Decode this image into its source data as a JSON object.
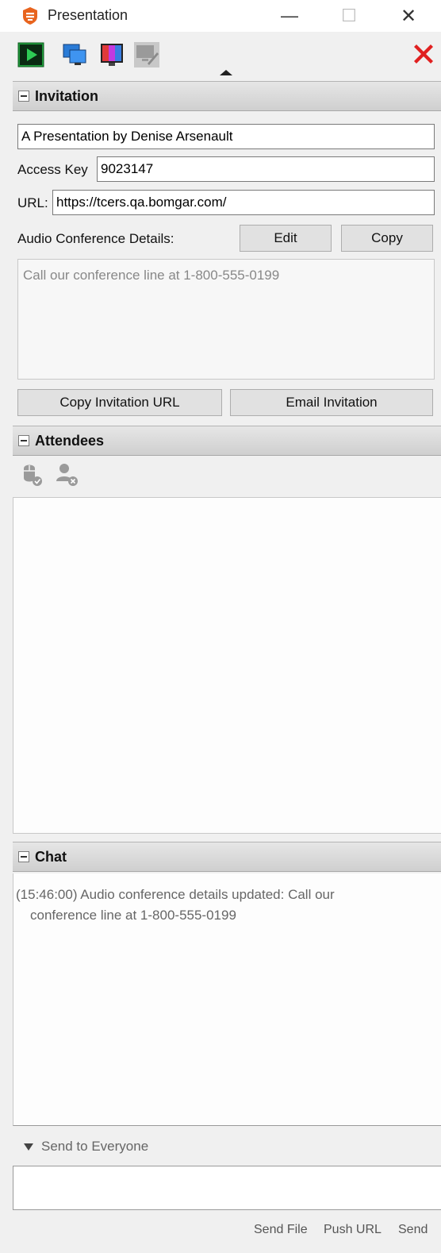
{
  "window": {
    "title": "Presentation",
    "minimize_glyph": "—",
    "maximize_glyph": "☐",
    "close_glyph": "✕"
  },
  "toolbar": {
    "icons": [
      "start-presentation-icon",
      "select-monitor-icon",
      "display-settings-icon",
      "annotation-disabled-icon",
      "end-presentation-icon"
    ],
    "close_color": "#e02020",
    "start_color": "#1f9d3b"
  },
  "invitation": {
    "section_title": "Invitation",
    "name_value": "A Presentation by Denise Arsenault",
    "access_key_label": "Access Key",
    "access_key_value": "9023147",
    "url_label": "URL:",
    "url_value": "https://tcers.qa.bomgar.com/",
    "audio_label": "Audio Conference Details:",
    "edit_label": "Edit",
    "copy_label": "Copy",
    "audio_details": "Call our conference line at 1-800-555-0199",
    "copy_url_label": "Copy Invitation URL",
    "email_label": "Email Invitation"
  },
  "attendees": {
    "section_title": "Attendees",
    "icons": [
      "grant-control-icon",
      "remove-attendee-icon"
    ]
  },
  "chat": {
    "section_title": "Chat",
    "message_line1": "(15:46:00) Audio conference details updated: Call our",
    "message_line2": "conference line at 1-800-555-0199",
    "send_to_label": "Send to Everyone",
    "send_file_label": "Send File",
    "push_url_label": "Push URL",
    "send_label": "Send"
  }
}
